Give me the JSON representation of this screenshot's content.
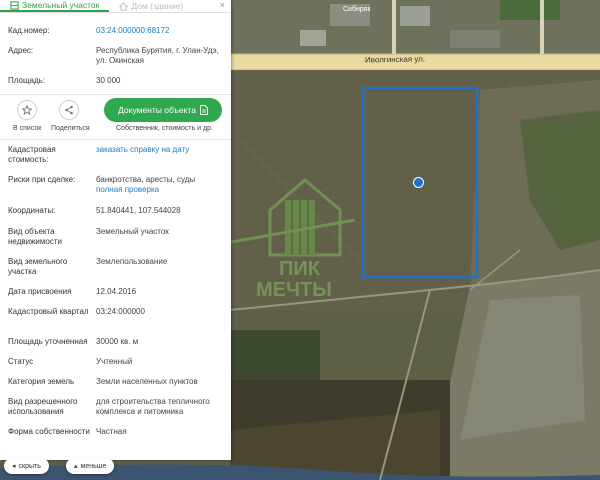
{
  "tabs": [
    {
      "label": "Земельный участок",
      "active": true
    },
    {
      "label": "Дом (здание)",
      "active": false
    }
  ],
  "close_symbol": "×",
  "header_fields": [
    {
      "label": "Кад.номер:",
      "value": "03:24:000000:68172",
      "link": true
    },
    {
      "label": "Адрес:",
      "value": "Республика Бурятия, г. Улан-Удэ, ул. Окинская",
      "link": false
    },
    {
      "label": "Площадь:",
      "value": "30 000",
      "link": false
    }
  ],
  "actions": {
    "favorite_label": "В список",
    "share_label": "Поделиться",
    "docs_button_label": "Документы объекта",
    "docs_subtitle": "Собственник, стоимость и др."
  },
  "detail_fields": [
    {
      "label": "Кадастровая стоимость:",
      "value": "заказать справку на дату",
      "link": true
    },
    {
      "label": "Риски при сделке:",
      "value": "банкротства, аресты, суды",
      "extra_link": "полная проверка"
    },
    {
      "label": "Координаты:",
      "value": "51.840441, 107.544028"
    },
    {
      "label": "Вид объекта недвижимости",
      "value": "Земельный участок"
    },
    {
      "label": "Вид земельного участка",
      "value": "Землепользование"
    },
    {
      "label": "Дата присвоения",
      "value": "12.04.2016"
    },
    {
      "label": "Кадастровый квартал",
      "value": "03:24:000000"
    },
    {
      "label": "Площадь уточненная",
      "value": "30000 кв. м"
    },
    {
      "label": "Статус",
      "value": "Учтенный"
    },
    {
      "label": "Категория земель",
      "value": "Земли населенных пунктов"
    },
    {
      "label": "Вид разрешенного использования",
      "value": "для строительства тепличного комплекса и питомника"
    },
    {
      "label": "Форма собственности",
      "value": "Частная"
    }
  ],
  "bottom": {
    "hide_label": "скрыть",
    "less_label": "меньше"
  },
  "map": {
    "street_label": "Иволгинская ул.",
    "top_label": "Сибиряк",
    "watermark_line1": "ПИК",
    "watermark_line2": "МЕЧТЫ",
    "colors": {
      "accent": "#2fa84f",
      "link": "#1d7fc4",
      "parcel": "#1e73c8"
    }
  }
}
